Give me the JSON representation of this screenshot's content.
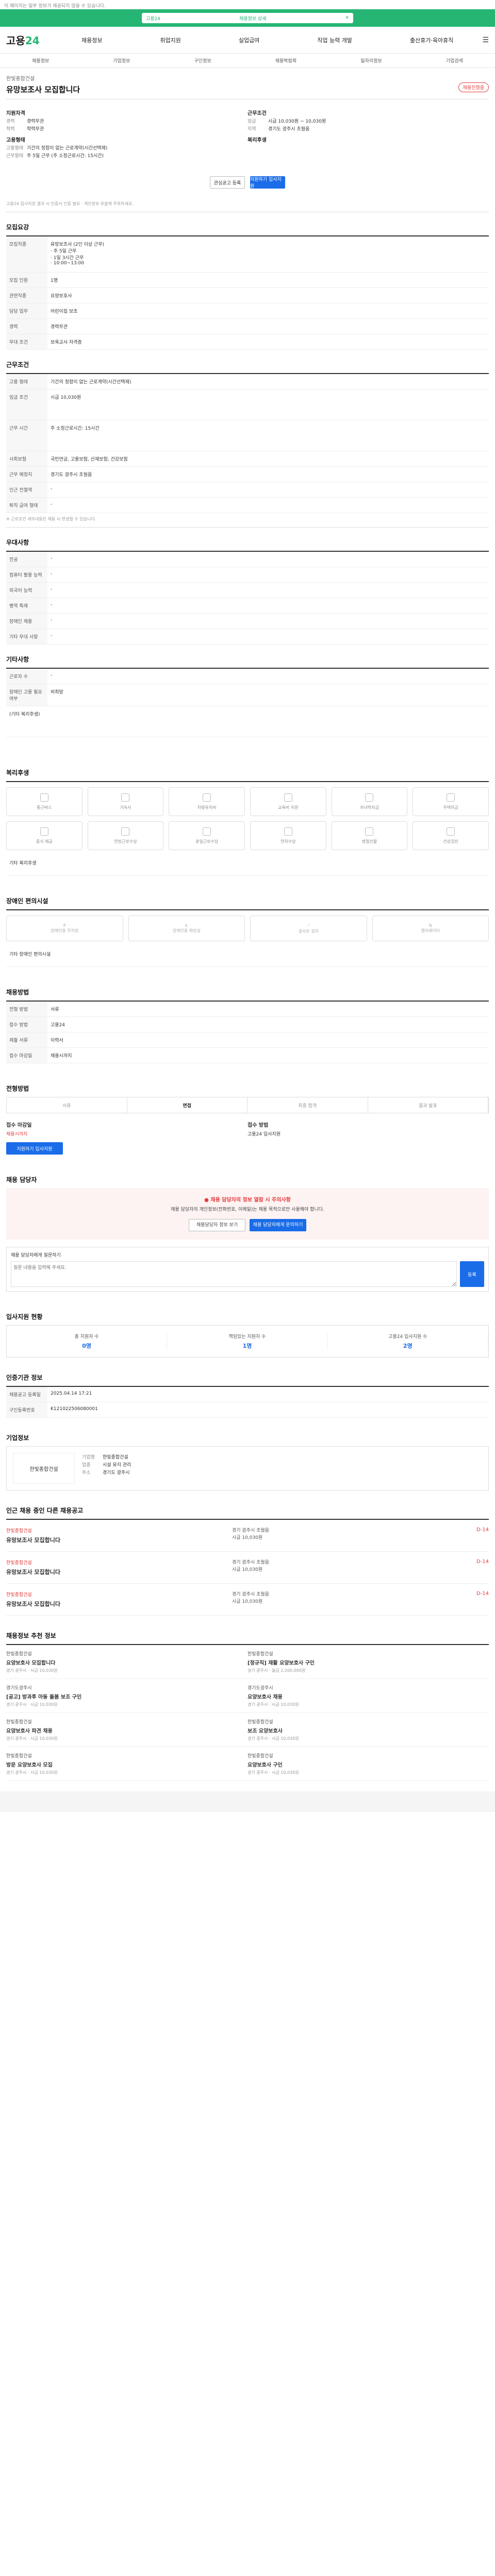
{
  "top_note": "이 페이지는 일부 정보가 제공되지 않을 수 있습니다.",
  "top_banner": {
    "left": "고용24",
    "center": "채용정보 상세"
  },
  "header": {
    "logo_a": "고용",
    "logo_b": "24",
    "nav": [
      "채용정보",
      "취업지원",
      "실업급여",
      "직업 능력 개발",
      "출산휴가·육아휴직"
    ]
  },
  "subnav": [
    "채용정보",
    "기업정보",
    "구인정보",
    "채용박람회",
    "일자리정보",
    "기업검색"
  ],
  "job": {
    "company": "한빛종합건설",
    "title": "유망보조사 모집합니다",
    "badge": "채용진행중"
  },
  "summary": {
    "left_title": "지원자격",
    "left_rows": [
      [
        "경력",
        "경력무관"
      ],
      [
        "학력",
        "학력무관"
      ]
    ],
    "left_title2": "고용형태",
    "left_rows2": [
      [
        "고용형태",
        "기간의 정함이 없는 근로계약(시간선택제)"
      ],
      [
        "근무형태",
        "주 5일 근무 (주 소정근로시간: 15시간)"
      ]
    ],
    "right_title": "근무조건",
    "right_rows": [
      [
        "임금",
        "시급 10,030원 ~ 10,030원"
      ],
      [
        "지역",
        "경기도 광주시 초월읍"
      ]
    ],
    "right_title2": "복리후생",
    "right_rows2": [
      [
        "",
        ""
      ]
    ]
  },
  "buttons": {
    "save": "관심공고 등록",
    "apply": "지원하기 입사지원"
  },
  "small_note": "고용24 입사지원 결과 시 인증서 인증 필요 · 개인정보 유출에 주의하세요.",
  "sec_recruit": {
    "title": "모집요강",
    "rows": [
      [
        "모집직종",
        "유망보조사 (2인 이상 근무)\n· 주 5일 근무\n· 1일 3시간 근무\n· 10:00~13:00"
      ],
      [
        "모집 인원",
        "1명"
      ],
      [
        "관련직종",
        "요양보호사"
      ],
      [
        "담당 업무",
        "어린이집 보조"
      ],
      [
        "경력",
        "경력무관"
      ],
      [
        "우대 조건",
        "보육교사 자격증"
      ]
    ]
  },
  "sec_cond": {
    "title": "근무조건",
    "rows": [
      [
        "고용 형태",
        "기간의 정함이 없는 근로계약(시간선택제)"
      ],
      [
        "임금 조건",
        "시급 10,030원"
      ],
      [
        "근무 시간",
        "주 소정근로시간: 15시간"
      ],
      [
        "사회보험",
        "국민연금, 고용보험, 산재보험, 건강보험"
      ],
      [
        "근무 예정지",
        "경기도 광주시 초월읍"
      ],
      [
        "인근 전철역",
        "-"
      ],
      [
        "퇴직 급여 형태",
        "-"
      ]
    ],
    "note": "※ 근로조건 세부내용은 채용 시 변경될 수 있습니다."
  },
  "sec_qual": {
    "title": "우대사항",
    "rows": [
      [
        "전공",
        "-"
      ],
      [
        "컴퓨터 활용 능력",
        "-"
      ],
      [
        "외국어 능력",
        "-"
      ],
      [
        "병역 특례",
        "-"
      ],
      [
        "장애인 채용",
        "-"
      ],
      [
        "기타 우대 사항",
        "-"
      ]
    ]
  },
  "sec_other": {
    "title": "기타사항",
    "rows": [
      [
        "근로자 수",
        "-"
      ],
      [
        "장애인 고용 필요 여부",
        "비희망"
      ]
    ],
    "extra": "(기타 복리후생)"
  },
  "sec_welfare": {
    "title": "복리후생",
    "items": [
      "통근버스",
      "기숙사",
      "차량유지비",
      "교육비 지원",
      "자녀학자금",
      "주택자금",
      "중식 제공",
      "연장근로수당",
      "휴일근로수당",
      "연차수당",
      "명절선물",
      "건강검진"
    ],
    "other": "기타 복리후생"
  },
  "sec_dis": {
    "title": "장애인 편의시설",
    "items": [
      "장애인용 주차장",
      "장애인용 화장실",
      "경사로 설치",
      "엘리베이터"
    ],
    "other": "기타 장애인 편의시설"
  },
  "sec_method": {
    "title": "채용방법",
    "rows": [
      [
        "전형 방법",
        "서류"
      ],
      [
        "접수 방법",
        "고용24"
      ],
      [
        "제출 서류",
        "이력서"
      ],
      [
        "접수 마감일",
        "채용시까지"
      ]
    ]
  },
  "sec_steps": {
    "title": "전형방법",
    "steps": [
      "서류",
      "면접",
      "최종 합격",
      "결과 발표"
    ],
    "left_title": "접수 마감일",
    "left_text": "채용시까지",
    "right_title": "접수 방법",
    "right_text": "고용24 입사지원",
    "apply": "지원하기 입사지원"
  },
  "sec_contact": {
    "title": "채용 담당자",
    "warn_title": "채용 담당자의 정보 열람 시 주의사항",
    "warn_body": "채용 담당자의 개인정보(전화번호, 이메일)는 채용 목적으로만 사용해야 합니다.",
    "btn1": "채용담당자 정보 보기",
    "btn2": "채용 담당자에게 문의하기",
    "qa_label": "채용 담당자에게 질문하기",
    "qa_placeholder": "질문 내용을 입력해 주세요.",
    "qa_submit": "등록"
  },
  "sec_stats": {
    "title": "입사지원 현황",
    "items": [
      [
        "총 지원자 수",
        "0명"
      ],
      [
        "책임있는 지원자 수",
        "1명"
      ],
      [
        "고용24 입사지원 수",
        "2명"
      ]
    ]
  },
  "sec_info": {
    "title": "인증기관 정보",
    "rows": [
      [
        "채용공고 등록일",
        "2025.04.14 17:21"
      ],
      [
        "구인등록번호",
        "K121022506080001"
      ]
    ]
  },
  "sec_company": {
    "title": "기업정보",
    "name": "한빛종합건설",
    "rows": [
      [
        "기업명",
        "한빛종합건설"
      ],
      [
        "업종",
        "시설 유지 관리"
      ],
      [
        "주소",
        "경기도 광주시"
      ]
    ]
  },
  "sec_list": {
    "title": "인근 채용 중인 다른 채용공고",
    "items": [
      {
        "co": "한빛종합건설",
        "tt": "유망보조사 모집합니다",
        "m1": "경기 광주시 초월읍",
        "m2": "시급 10,030원",
        "d": "D-14"
      },
      {
        "co": "한빛종합건설",
        "tt": "유망보조사 모집합니다",
        "m1": "경기 광주시 초월읍",
        "m2": "시급 10,030원",
        "d": "D-14"
      },
      {
        "co": "한빛종합건설",
        "tt": "유망보조사 모집합니다",
        "m1": "경기 광주시 초월읍",
        "m2": "시급 10,030원",
        "d": "D-14"
      }
    ]
  },
  "sec_rec": {
    "title": "채용정보 추천 정보",
    "items": [
      {
        "co": "한빛종합건설",
        "tt": "요양보호사 모집합니다",
        "mt": "경기 광주시 · 시급 10,030원"
      },
      {
        "co": "한빛종합건설",
        "tt": "[정규직] 재활 요양보호사 구인",
        "mt": "경기 광주시 · 월급 2,200,000원"
      },
      {
        "co": "경기도광주시",
        "tt": "[공고] 방과후 아동 돌봄 보조 구인",
        "mt": "경기 광주시 · 시급 10,030원"
      },
      {
        "co": "경기도광주시",
        "tt": "요양보호사 채용",
        "mt": "경기 광주시 · 시급 10,030원"
      },
      {
        "co": "한빛종합건설",
        "tt": "요양보호사 파견 채용",
        "mt": "경기 광주시 · 시급 10,030원"
      },
      {
        "co": "한빛종합건설",
        "tt": "보조 요양보호사",
        "mt": "경기 광주시 · 시급 10,030원"
      },
      {
        "co": "한빛종합건설",
        "tt": "방문 요양보호사 모집",
        "mt": "경기 광주시 · 시급 10,030원"
      },
      {
        "co": "한빛종합건설",
        "tt": "요양보호사 구인",
        "mt": "경기 광주시 · 시급 10,030원"
      }
    ]
  }
}
